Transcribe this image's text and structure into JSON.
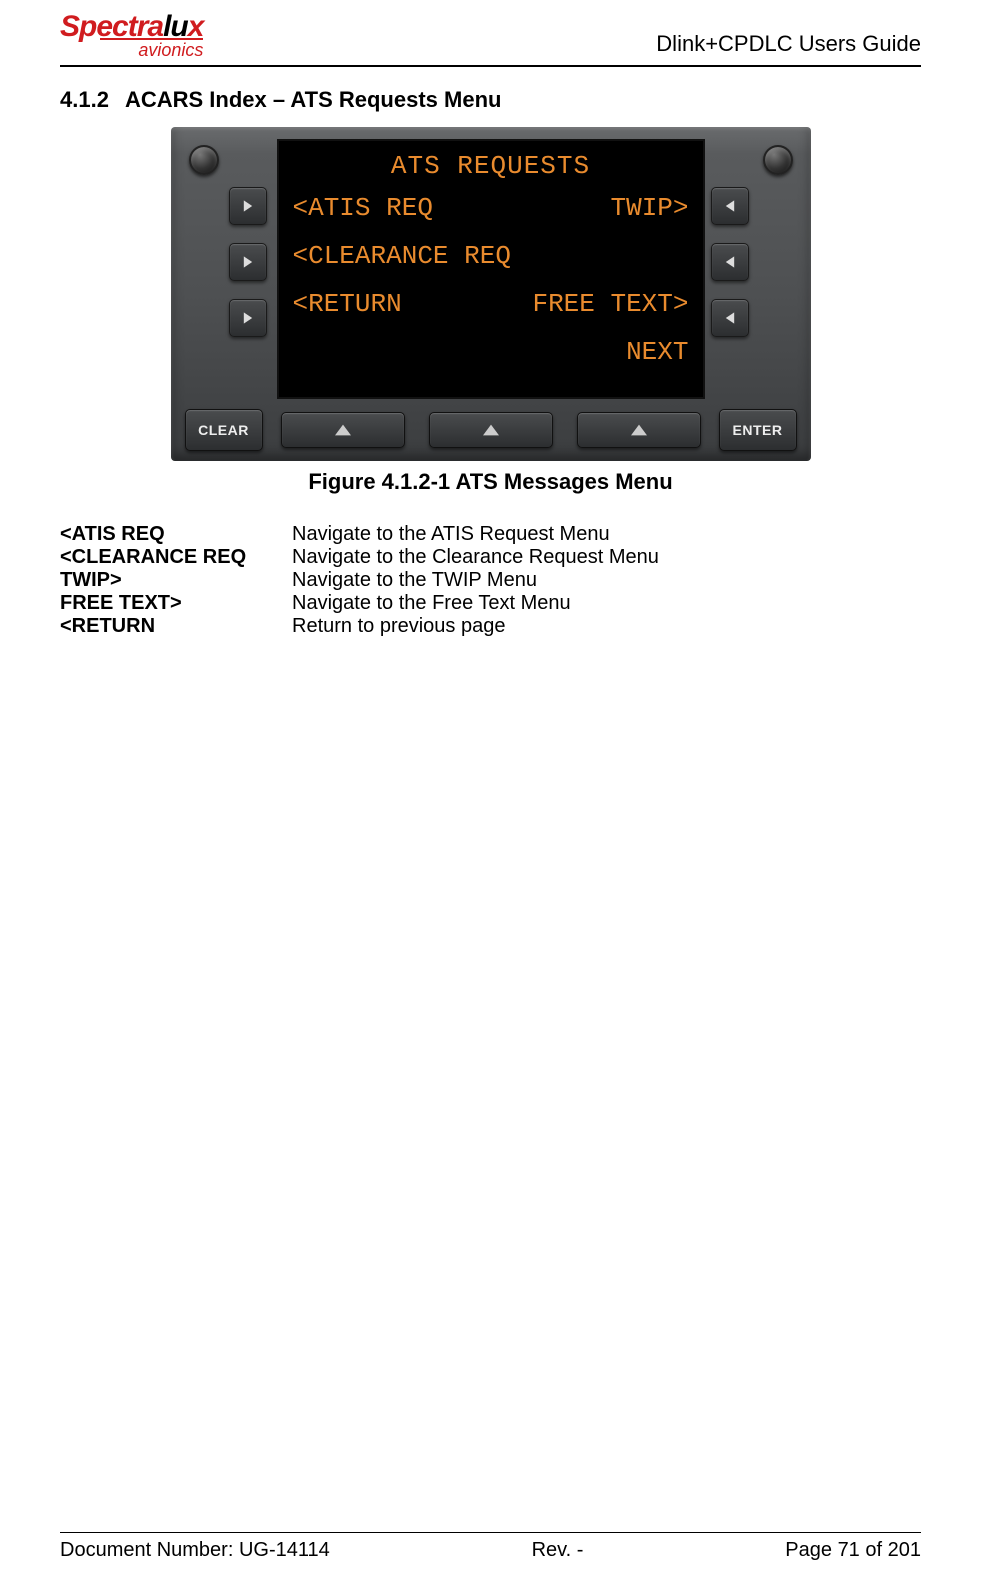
{
  "header": {
    "logo_text1": "Spectra",
    "logo_text2": "lu",
    "logo_text3": "x",
    "logo_sub": "avionics",
    "doc_title": "Dlink+CPDLC Users Guide"
  },
  "section": {
    "number": "4.1.2",
    "title": "ACARS Index – ATS Requests Menu"
  },
  "screen": {
    "title": "ATS REQUESTS",
    "row1_left": "<ATIS REQ",
    "row1_right": "TWIP>",
    "row2_left": "<CLEARANCE REQ",
    "row2_right": "",
    "row3_left": "<RETURN",
    "row3_right": "FREE TEXT>",
    "row4_left": "",
    "row4_right": "NEXT"
  },
  "buttons": {
    "clear": "CLEAR",
    "enter": "ENTER"
  },
  "caption": "Figure 4.1.2-1 ATS Messages Menu",
  "defs": [
    {
      "term": "<ATIS REQ",
      "desc": "Navigate to the ATIS Request Menu"
    },
    {
      "term": "<CLEARANCE REQ",
      "desc": "Navigate to the Clearance Request Menu"
    },
    {
      "term": "TWIP>",
      "desc": "Navigate to the TWIP Menu"
    },
    {
      "term": "FREE TEXT>",
      "desc": "Navigate to the Free Text Menu"
    },
    {
      "term": "<RETURN",
      "desc": "Return to previous page"
    }
  ],
  "footer": {
    "doc_num": "Document Number:  UG-14114",
    "rev": "Rev. -",
    "page": "Page 71 of 201"
  }
}
